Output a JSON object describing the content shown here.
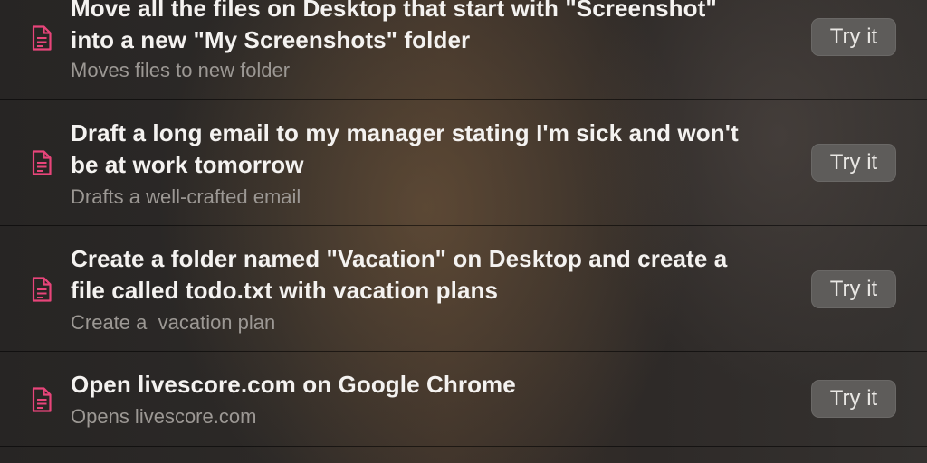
{
  "colors": {
    "icon": "#e8457a",
    "button_bg": "#5e5c5a",
    "title_text": "#f4f2f0",
    "subtitle_text": "#9c9894"
  },
  "items": [
    {
      "icon": "document-icon",
      "title_line1": "Move all the files on Desktop that start with \"Screenshot\"",
      "title_line2": "into a new \"My Screenshots\" folder",
      "subtitle": "Moves files to new folder",
      "button_label": "Try it"
    },
    {
      "icon": "document-icon",
      "title_line1": "Draft a long email to my manager stating I'm sick and won't",
      "title_line2": "be at work tomorrow",
      "subtitle": "Drafts a well-crafted email",
      "button_label": "Try it"
    },
    {
      "icon": "document-icon",
      "title_line1": "Create a folder named \"Vacation\" on Desktop and create a",
      "title_line2": "file called todo.txt with vacation plans",
      "subtitle": "Create a  vacation plan",
      "button_label": "Try it"
    },
    {
      "icon": "document-icon",
      "title_line1": "Open livescore.com on Google Chrome",
      "subtitle": "Opens livescore.com",
      "button_label": "Try it"
    }
  ]
}
